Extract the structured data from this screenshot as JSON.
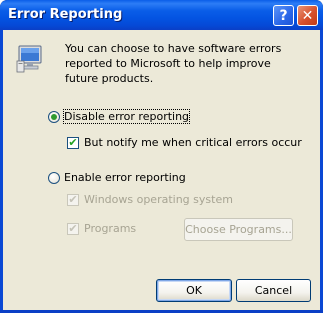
{
  "window": {
    "title": "Error Reporting",
    "help_glyph": "?",
    "close_glyph": "✕"
  },
  "message": "You can choose to have software errors reported to Microsoft to help improve future products.",
  "options": {
    "disable": {
      "label": "Disable error reporting",
      "selected": true
    },
    "notify": {
      "label": "But notify me when critical errors occur",
      "checked": true
    },
    "enable": {
      "label": "Enable error reporting",
      "selected": false
    },
    "windows_os": {
      "label": "Windows operating system",
      "checked": true,
      "enabled": false
    },
    "programs": {
      "label": "Programs",
      "checked": true,
      "enabled": false
    }
  },
  "buttons": {
    "choose_programs": "Choose Programs...",
    "ok": "OK",
    "cancel": "Cancel"
  },
  "icons": {
    "info": "computer-monitor-icon",
    "check": "✔"
  }
}
